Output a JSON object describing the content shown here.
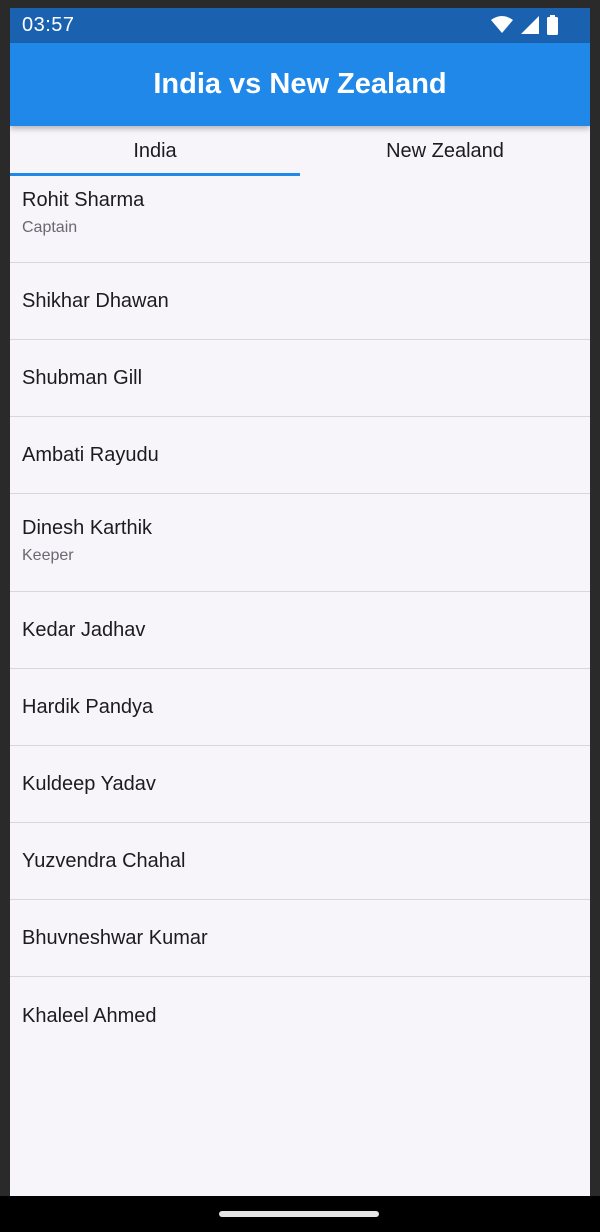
{
  "status_bar": {
    "time": "03:57",
    "icons": [
      "wifi-icon",
      "signal-icon",
      "battery-icon"
    ]
  },
  "app_bar": {
    "title": "India vs New Zealand",
    "color": "#1f88e8"
  },
  "tabs": [
    {
      "label": "India",
      "selected": true
    },
    {
      "label": "New Zealand",
      "selected": false
    }
  ],
  "players": [
    {
      "name": "Rohit Sharma",
      "role": "Captain"
    },
    {
      "name": "Shikhar Dhawan",
      "role": ""
    },
    {
      "name": "Shubman Gill",
      "role": ""
    },
    {
      "name": "Ambati Rayudu",
      "role": ""
    },
    {
      "name": "Dinesh Karthik",
      "role": "Keeper"
    },
    {
      "name": "Kedar Jadhav",
      "role": ""
    },
    {
      "name": "Hardik Pandya",
      "role": ""
    },
    {
      "name": "Kuldeep Yadav",
      "role": ""
    },
    {
      "name": "Yuzvendra Chahal",
      "role": ""
    },
    {
      "name": "Bhuvneshwar Kumar",
      "role": ""
    },
    {
      "name": "Khaleel Ahmed",
      "role": ""
    }
  ]
}
